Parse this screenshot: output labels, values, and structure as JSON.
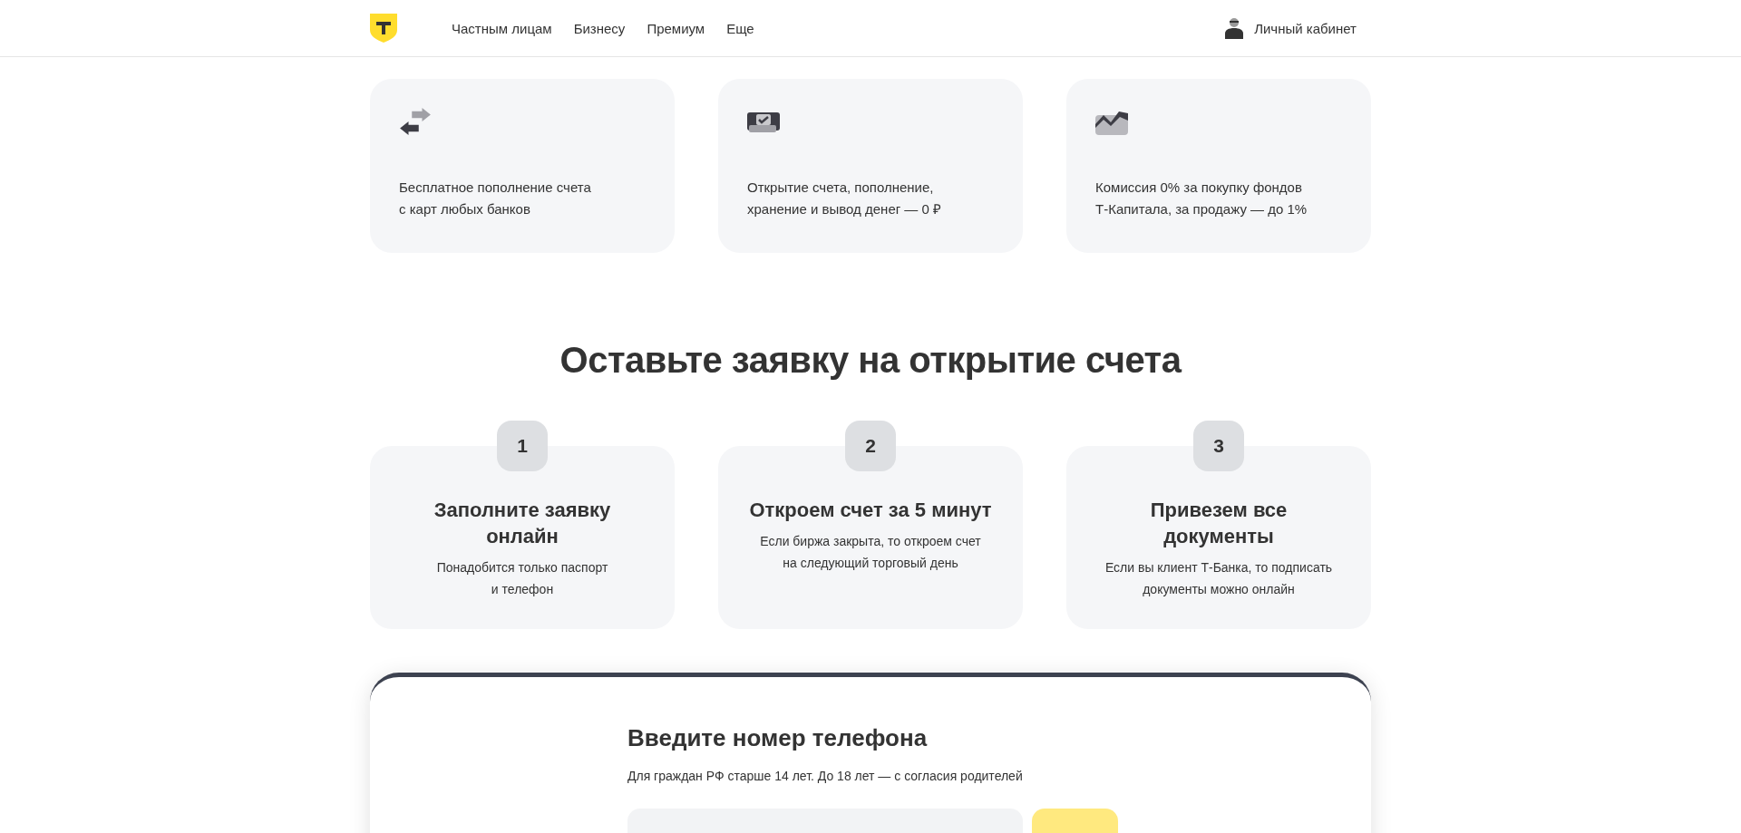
{
  "header": {
    "nav": [
      "Частным лицам",
      "Бизнесу",
      "Премиум",
      "Еще"
    ],
    "account": "Личный кабинет"
  },
  "features": [
    {
      "text": "Бесплатное пополнение счета\nс карт любых банков"
    },
    {
      "text": "Открытие счета, пополнение,\nхранение и вывод денег — 0 ₽"
    },
    {
      "text": "Комиссия 0% за покупку фондов\nТ-Капитала, за продажу — до 1%"
    }
  ],
  "steps_title": "Оставьте заявку на открытие счета",
  "steps": [
    {
      "number": "1",
      "title": "Заполните заявку\nонлайн",
      "text": "Понадобится только паспорт\nи телефон"
    },
    {
      "number": "2",
      "title": "Откроем счет за 5 минут",
      "text": "Если биржа закрыта, то откроем счет\nна следующий торговый день"
    },
    {
      "number": "3",
      "title": "Привезем все\nдокументы",
      "text": "Если вы клиент Т-Банка, то подписать\nдокументы можно онлайн"
    }
  ],
  "form": {
    "title": "Введите номер телефона",
    "subtitle": "Для граждан РФ старше 14 лет. До 18 лет — с согласия родителей"
  }
}
